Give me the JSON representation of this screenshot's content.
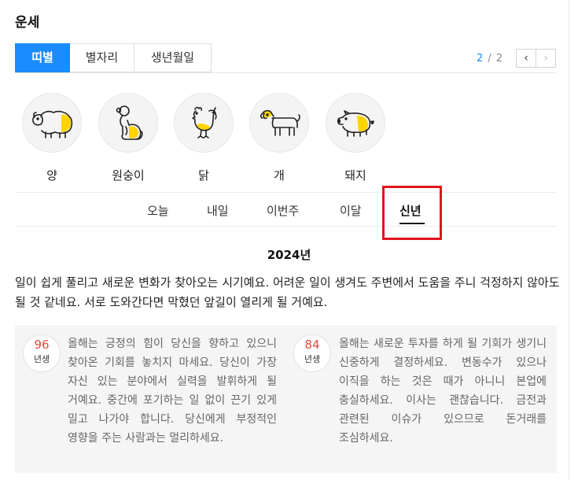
{
  "header": {
    "title": "운세"
  },
  "tabs": [
    {
      "label": "띠별",
      "active": true
    },
    {
      "label": "별자리",
      "active": false
    },
    {
      "label": "생년월일",
      "active": false
    }
  ],
  "pager": {
    "current": "2",
    "separator": "/",
    "total": "2",
    "prev_icon": "chevron-left-icon",
    "next_icon": "chevron-right-icon"
  },
  "animals": [
    {
      "label": "양",
      "icon": "sheep-icon"
    },
    {
      "label": "원숭이",
      "icon": "monkey-icon"
    },
    {
      "label": "닭",
      "icon": "rooster-icon"
    },
    {
      "label": "개",
      "icon": "dog-icon"
    },
    {
      "label": "돼지",
      "icon": "pig-icon"
    }
  ],
  "period_tabs": [
    {
      "label": "오늘",
      "active": false
    },
    {
      "label": "내일",
      "active": false
    },
    {
      "label": "이번주",
      "active": false
    },
    {
      "label": "이달",
      "active": false
    },
    {
      "label": "신년",
      "active": true
    }
  ],
  "fortune": {
    "year": "2024년",
    "summary": "일이 쉽게 풀리고 새로운 변화가 찾아오는 시기예요. 어려운 일이 생겨도 주변에서 도움을 주니 걱정하지 않아도 될 것 같네요. 서로 도와간다면 막혔던 앞길이 열리게 될 거예요.",
    "details": [
      {
        "birth": "96",
        "unit": "년생",
        "text": "올해는 긍정의 힘이 당신을 향하고 있으니 찾아온 기회를 놓치지 마세요. 당신이 가장 자신 있는 분야에서 실력을 발휘하게 될 거예요. 중간에 포기하는 일 없이 끈기 있게 밀고 나가야 합니다. 당신에게 부정적인 영향을 주는 사람과는 멀리하세요."
      },
      {
        "birth": "84",
        "unit": "년생",
        "text": "올해는 새로운 투자를 하게 될 기회가 생기니 신중하게 결정하세요. 변동수가 있으나 이직을 하는 것은 때가 아니니 본업에 충실하세요. 이사는 괜찮습니다. 금전과 관련된 이슈가 있으므로 돈거래를 조심하세요."
      }
    ]
  },
  "colors": {
    "accent": "#1a8cff",
    "highlight": "#e3141e",
    "badge_number": "#e44a3c",
    "animal_fill": "#ffd400"
  }
}
